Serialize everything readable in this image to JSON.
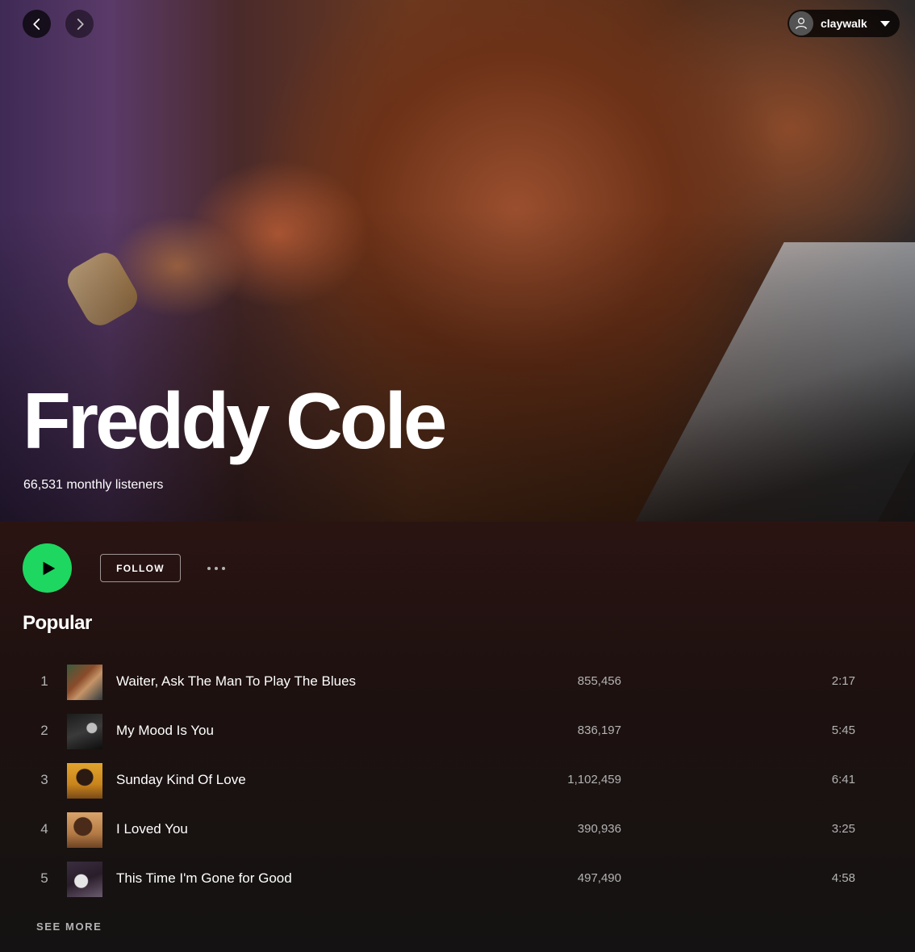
{
  "header": {
    "username": "claywalk"
  },
  "artist": {
    "name": "Freddy Cole",
    "monthly_listeners": "66,531 monthly listeners"
  },
  "actions": {
    "follow_label": "FOLLOW"
  },
  "popular": {
    "title": "Popular",
    "tracks": [
      {
        "number": "1",
        "title": "Waiter, Ask The Man To Play The Blues",
        "plays": "855,456",
        "duration": "2:17"
      },
      {
        "number": "2",
        "title": "My Mood Is You",
        "plays": "836,197",
        "duration": "5:45"
      },
      {
        "number": "3",
        "title": "Sunday Kind Of Love",
        "plays": "1,102,459",
        "duration": "6:41"
      },
      {
        "number": "4",
        "title": "I Loved You",
        "plays": "390,936",
        "duration": "3:25"
      },
      {
        "number": "5",
        "title": "This Time I'm Gone for Good",
        "plays": "497,490",
        "duration": "4:58"
      }
    ],
    "see_more_label": "SEE MORE"
  },
  "colors": {
    "accent": "#1ed760",
    "background": "#121212",
    "secondary_text": "#b3b3b3"
  },
  "icons": {
    "back": "chevron-left-icon",
    "forward": "chevron-right-icon",
    "user": "user-icon",
    "dropdown": "caret-down-icon",
    "play": "play-icon",
    "more": "more-icon"
  }
}
